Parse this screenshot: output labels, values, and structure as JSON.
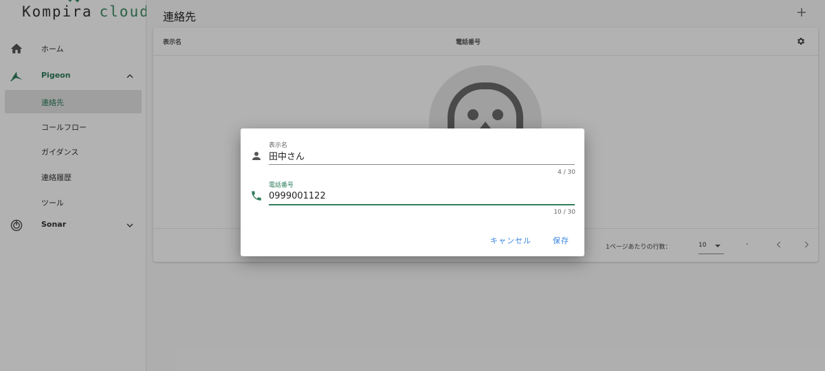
{
  "app": {
    "logo_left": "Kompira",
    "logo_right": "cloud",
    "accent": "#2e7d5b"
  },
  "sidebar": {
    "items": [
      {
        "label": "ホーム",
        "icon": "home-icon"
      },
      {
        "label": "Pigeon",
        "icon": "pigeon-icon",
        "expanded": true
      },
      {
        "label": "連絡先",
        "active": true
      },
      {
        "label": "コールフロー"
      },
      {
        "label": "ガイダンス"
      },
      {
        "label": "連絡履歴"
      },
      {
        "label": "ツール"
      },
      {
        "label": "Sonar",
        "icon": "sonar-icon",
        "expanded": false
      }
    ]
  },
  "header": {
    "title": "連絡先",
    "add_icon": "plus-icon"
  },
  "table": {
    "columns": [
      "表示名",
      "電話番号"
    ],
    "settings_icon": "gear-icon",
    "footer": {
      "rows_per_page_label": "1ページあたりの行数：",
      "rows_per_page": "10",
      "range": "-"
    }
  },
  "dialog": {
    "name_field": {
      "label": "表示名",
      "value": "田中さん",
      "counter": "4 / 30",
      "icon": "person-icon"
    },
    "phone_field": {
      "label": "電話番号",
      "value": "0999001122",
      "counter": "10 / 30",
      "icon": "phone-icon"
    },
    "cancel_label": "キャンセル",
    "save_label": "保存",
    "button_color": "#3b86e0"
  }
}
